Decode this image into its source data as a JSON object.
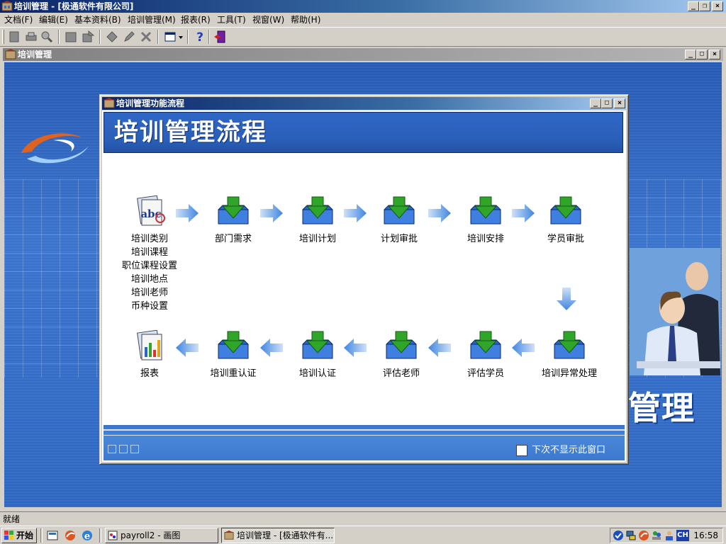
{
  "window": {
    "title": "培训管理 - [极通软件有限公司]",
    "controls": {
      "minimize": "_",
      "restore": "❐",
      "close": "×"
    }
  },
  "menu": {
    "items": [
      {
        "label": "文档(F)"
      },
      {
        "label": "编辑(E)"
      },
      {
        "label": "基本资料(B)"
      },
      {
        "label": "培训管理(M)"
      },
      {
        "label": "报表(R)"
      },
      {
        "label": "工具(T)"
      },
      {
        "label": "视窗(W)"
      },
      {
        "label": "帮助(H)"
      }
    ]
  },
  "toolbar": {
    "icons": [
      "new-icon",
      "print-icon",
      "preview-icon",
      "save-icon",
      "export-icon",
      "tag-icon",
      "edit-icon",
      "delete-icon",
      "window-layout-icon",
      "help-icon",
      "exit-icon"
    ]
  },
  "mdi_child": {
    "title": "培训管理",
    "background_text": "管理"
  },
  "dialog": {
    "title": "培训管理功能流程",
    "banner_title": "培训管理流程",
    "flow_top": [
      {
        "label": "培训类别\n培训课程\n职位课程设置\n培训地点\n培训老师\n币种设置",
        "icon": "abc-book-icon"
      },
      {
        "label": "部门需求",
        "icon": "inbox-download-icon"
      },
      {
        "label": "培训计划",
        "icon": "inbox-download-icon"
      },
      {
        "label": "计划审批",
        "icon": "inbox-download-icon"
      },
      {
        "label": "培训安排",
        "icon": "inbox-download-icon"
      },
      {
        "label": "学员审批",
        "icon": "inbox-download-icon"
      }
    ],
    "flow_bottom": [
      {
        "label": "报表",
        "icon": "report-book-icon"
      },
      {
        "label": "培训重认证",
        "icon": "inbox-download-icon"
      },
      {
        "label": "培训认证",
        "icon": "inbox-download-icon"
      },
      {
        "label": "评估老师",
        "icon": "inbox-download-icon"
      },
      {
        "label": "评估学员",
        "icon": "inbox-download-icon"
      },
      {
        "label": "培训异常处理",
        "icon": "inbox-download-icon"
      }
    ],
    "dont_show_label": "下次不显示此窗口",
    "dont_show_checked": false
  },
  "statusbar": {
    "text": "就绪"
  },
  "taskbar": {
    "start_label": "开始",
    "tasks": [
      {
        "label": "payroll2 - 画图",
        "active": false
      },
      {
        "label": "培训管理 - [极通软件有...",
        "active": true
      }
    ],
    "tray_lang": "CH",
    "clock": "16:58"
  },
  "colors": {
    "title_active": "#0a246a",
    "banner_blue": "#2f67c6",
    "arrow_blue": "#4a8de0",
    "icon_green": "#2fa52a",
    "icon_blue": "#2b67c9"
  }
}
